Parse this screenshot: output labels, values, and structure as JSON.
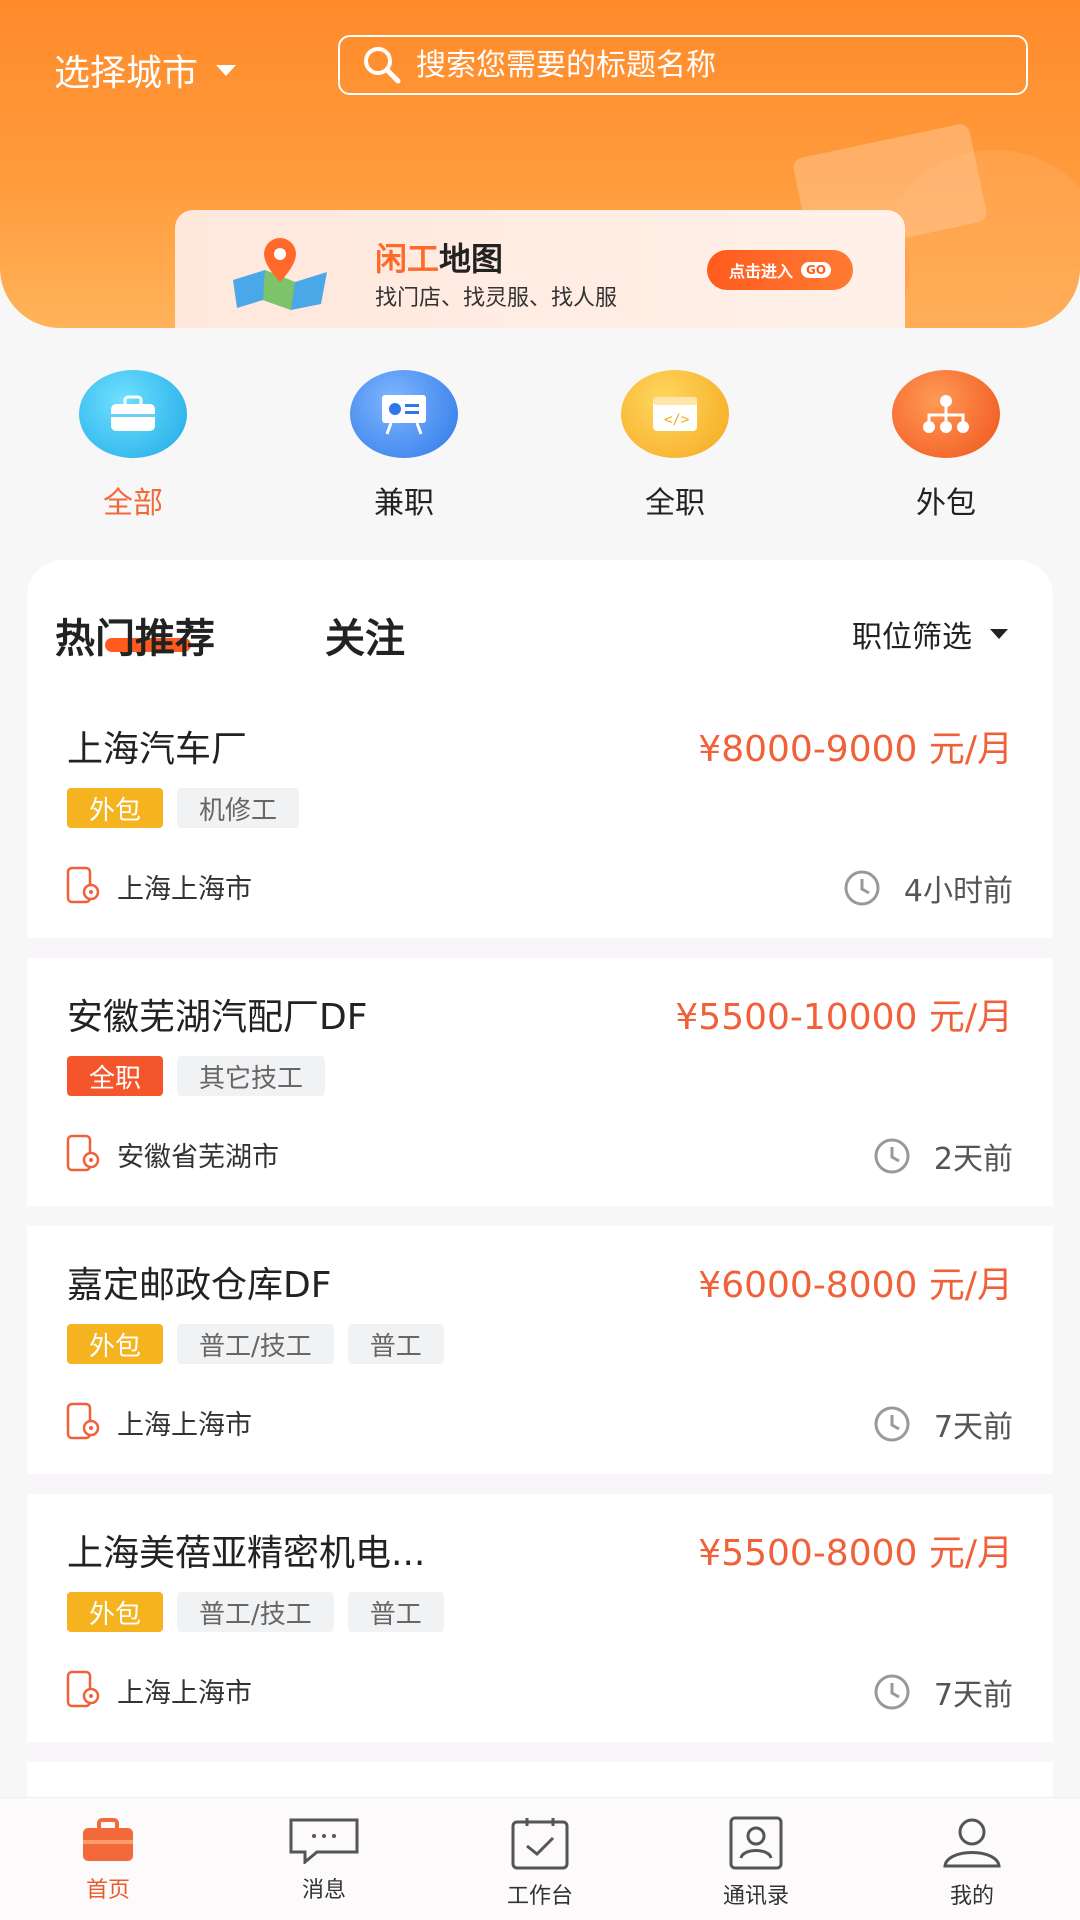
{
  "header": {
    "city_label": "选择城市",
    "search_placeholder": "搜索您需要的标题名称"
  },
  "banner": {
    "title_accent": "闲工",
    "title_rest": "地图",
    "subtitle": "找门店、找灵服、找人服",
    "enter_label": "点击进入",
    "go_label": "GO"
  },
  "categories": [
    {
      "label": "全部",
      "icon": "briefcase-icon",
      "active": true
    },
    {
      "label": "兼职",
      "icon": "presentation-icon"
    },
    {
      "label": "全职",
      "icon": "code-window-icon"
    },
    {
      "label": "外包",
      "icon": "org-chart-icon"
    }
  ],
  "tabs": {
    "hot": "热门推荐",
    "follow": "关注",
    "filter": "职位筛选"
  },
  "jobs": [
    {
      "title": "上海汽车厂",
      "salary": "¥8000-9000 元/月",
      "tags": [
        "外包",
        "机修工"
      ],
      "location": "上海上海市",
      "time": "4小时前"
    },
    {
      "title": "安徽芜湖汽配厂DF",
      "salary": "¥5500-10000 元/月",
      "tags": [
        "全职",
        "其它技工"
      ],
      "location": "安徽省芜湖市",
      "time": "2天前"
    },
    {
      "title": "嘉定邮政仓库DF",
      "salary": "¥6000-8000 元/月",
      "tags": [
        "外包",
        "普工/技工",
        "普工"
      ],
      "location": "上海上海市",
      "time": "7天前"
    },
    {
      "title": "上海美蓓亚精密机电...",
      "salary": "¥5500-8000 元/月",
      "tags": [
        "外包",
        "普工/技工",
        "普工"
      ],
      "location": "上海上海市",
      "time": "7天前"
    }
  ],
  "nav": [
    {
      "label": "首页",
      "icon": "home-briefcase-icon",
      "active": true
    },
    {
      "label": "消息",
      "icon": "message-icon"
    },
    {
      "label": "工作台",
      "icon": "workbench-icon"
    },
    {
      "label": "通讯录",
      "icon": "contacts-icon"
    },
    {
      "label": "我的",
      "icon": "profile-icon"
    }
  ],
  "colors": {
    "brand": "#ff8a2a",
    "accent": "#f0613a",
    "tag_outsource": "#f5b320",
    "tag_fulltime": "#f4552a"
  }
}
